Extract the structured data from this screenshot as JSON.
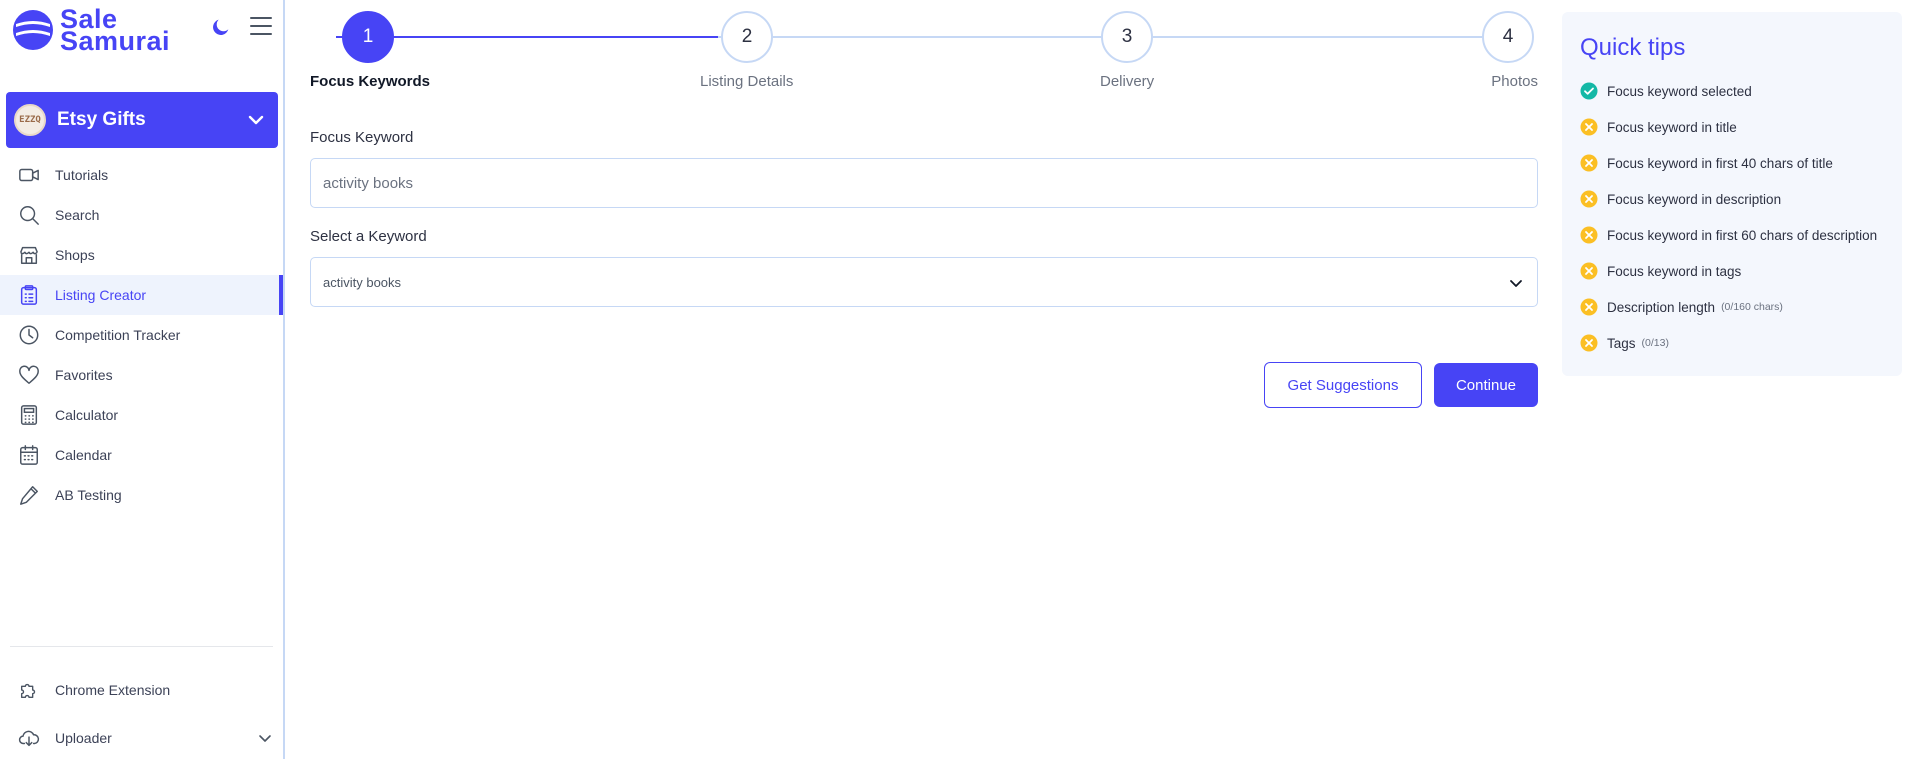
{
  "brand": {
    "line1": "Sale",
    "line2": "Samurai",
    "color": "#4744f5"
  },
  "shop": {
    "name": "Etsy Gifts",
    "avatar_text": "EZZQ"
  },
  "sidebar": {
    "items": [
      {
        "label": "Tutorials",
        "icon": "video-icon"
      },
      {
        "label": "Search",
        "icon": "search-icon"
      },
      {
        "label": "Shops",
        "icon": "store-icon"
      },
      {
        "label": "Listing Creator",
        "icon": "clipboard-icon",
        "active": true
      },
      {
        "label": "Competition Tracker",
        "icon": "clock-icon"
      },
      {
        "label": "Favorites",
        "icon": "heart-icon"
      },
      {
        "label": "Calculator",
        "icon": "calculator-icon"
      },
      {
        "label": "Calendar",
        "icon": "calendar-icon"
      },
      {
        "label": "AB Testing",
        "icon": "pen-icon"
      }
    ],
    "bottom": [
      {
        "label": "Chrome Extension",
        "icon": "puzzle-icon"
      },
      {
        "label": "Uploader",
        "icon": "cloud-download-icon"
      }
    ]
  },
  "stepper": {
    "steps": [
      {
        "number": "1",
        "label": "Focus Keywords",
        "active": true
      },
      {
        "number": "2",
        "label": "Listing Details"
      },
      {
        "number": "3",
        "label": "Delivery"
      },
      {
        "number": "4",
        "label": "Photos"
      }
    ]
  },
  "form": {
    "focus_keyword_label": "Focus Keyword",
    "focus_keyword_value": "activity books",
    "select_keyword_label": "Select a Keyword",
    "select_keyword_value": "activity books",
    "get_suggestions_label": "Get Suggestions",
    "continue_label": "Continue"
  },
  "tips": {
    "title": "Quick tips",
    "items": [
      {
        "label": "Focus keyword selected",
        "status": "done"
      },
      {
        "label": "Focus keyword in title",
        "status": "pending"
      },
      {
        "label": "Focus keyword in first 40 chars of title",
        "status": "pending"
      },
      {
        "label": "Focus keyword in description",
        "status": "pending"
      },
      {
        "label": "Focus keyword in first 60 chars of description",
        "status": "pending"
      },
      {
        "label": "Focus keyword in tags",
        "status": "pending"
      },
      {
        "label": "Description length",
        "count": "(0/160 chars)",
        "status": "pending"
      },
      {
        "label": "Tags",
        "count": "(0/13)",
        "status": "pending"
      }
    ]
  },
  "colors": {
    "accent": "#4744f5",
    "done": "#14b8a6",
    "pending": "#fbbf24",
    "border": "#c6d8f5"
  }
}
